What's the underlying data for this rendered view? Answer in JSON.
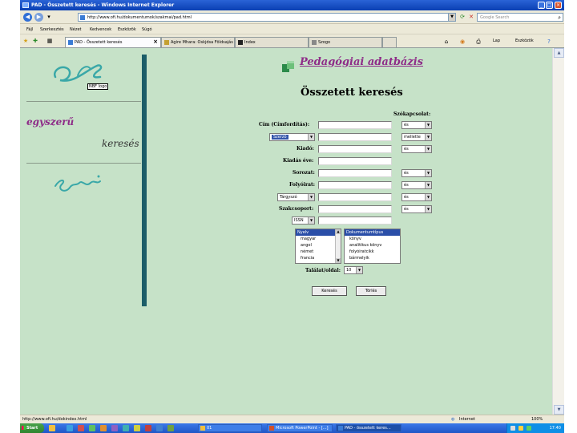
{
  "window": {
    "title": "PAD - Összetett keresés - Windows Internet Explorer",
    "address": "http://www.ofi.hu/dokumentumok/szakmai/pad.html",
    "search_placeholder": "Google Search"
  },
  "menu": [
    "Fájl",
    "Szerkesztés",
    "Nézet",
    "Kedvencek",
    "Eszközök",
    "Súgó"
  ],
  "tabs": [
    {
      "label": "PAD - Összetett keresés",
      "active": true
    },
    {
      "label": "Agire Mhara: Oskjdsa Földsajás",
      "active": false
    },
    {
      "label": "Index",
      "active": false
    },
    {
      "label": "Szogo",
      "active": false
    }
  ],
  "toolbar": {
    "page": "Lap",
    "tools": "Eszközök"
  },
  "left": {
    "logo_caption": "NBF logo",
    "link_simple": "egyszerű",
    "link_search": "keresés"
  },
  "header": {
    "db_title": "Pedagógiai adatbázis",
    "form_title": "Összetett keresés",
    "word_match_label": "Szókapcsolat:"
  },
  "form": {
    "rows": [
      {
        "label": "Cím (Címfordítás):",
        "value": "",
        "op": "és"
      },
      {
        "label": "Szerző",
        "value": "",
        "op": "mellette",
        "label_is_select": true
      },
      {
        "label": "Kiadó:",
        "value": "",
        "op": "és"
      },
      {
        "label": "Kiadás éve:",
        "value": ""
      },
      {
        "label": "Sorozat:",
        "value": "",
        "op": "és"
      },
      {
        "label": "Folyóirat:",
        "value": "",
        "op": "és"
      },
      {
        "label": "Tárgyszó",
        "value": "",
        "op": "és",
        "label_is_select": true
      },
      {
        "label": "Szakcsoport:",
        "value": "",
        "op": "és"
      },
      {
        "label": "ISSN",
        "value": "",
        "label_is_select": true
      }
    ],
    "language_list": {
      "header": "Nyelv",
      "items": [
        "magyar",
        "angol",
        "német",
        "francia"
      ]
    },
    "doctype_list": {
      "header": "Dokumentumtípus",
      "items": [
        "könyv",
        "analitikus könyv",
        "folyóiratcikk",
        "bármelyik"
      ]
    },
    "results_per_page_label": "Találat/oldal:",
    "results_per_page": "10",
    "search_button": "Keresés",
    "clear_button": "Törlés"
  },
  "statusbar": {
    "url": "http://www.ofi.hu/dokindex.html",
    "zone": "Internet",
    "zoom": "100%"
  },
  "taskbar": {
    "start": "Start",
    "tasks": [
      {
        "label": "01",
        "active": false
      },
      {
        "label": "Microsoft PowerPoint - [...]",
        "active": false
      },
      {
        "label": "PAD - összetett keres...",
        "active": true
      }
    ],
    "clock": "17:40"
  },
  "colors": {
    "page_bg": "#c6e2c8",
    "brand_purple": "#8e2c88",
    "bar_teal": "#1b5d68"
  }
}
